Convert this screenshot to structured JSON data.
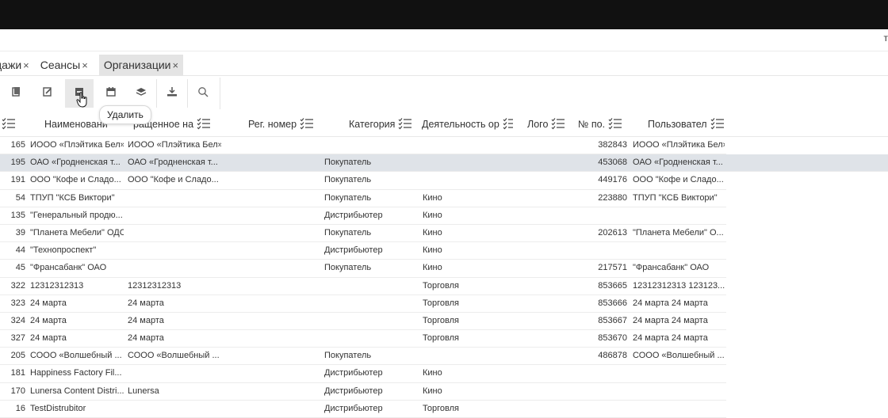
{
  "header": {
    "right_mark": "т"
  },
  "tabs": [
    {
      "label": "дажи",
      "close": "×"
    },
    {
      "label": "Сеансы",
      "close": "×"
    },
    {
      "label": "Организации",
      "close": "×",
      "active": true
    }
  ],
  "toolbar": {
    "buttons": [
      "copy-icon",
      "edit-icon",
      "delete-icon",
      "calendar-icon",
      "layers-icon",
      "download-icon",
      "search-icon"
    ],
    "tooltip": "Удалить"
  },
  "columns": {
    "name": "Наименовани",
    "short": "ращенное на",
    "reg": "Рег. номер",
    "category": "Категория",
    "activity": "Деятельность ор",
    "logo": "Лого",
    "num": "№ по.",
    "user": "Пользовател"
  },
  "rows": [
    {
      "id": "165",
      "name": "ИООО «Плэйтика Бел»",
      "short": "ИООО «Плэйтика Бел»",
      "category": "",
      "activity": "",
      "num": "382843",
      "user": "ИООО «Плэйтика Бел»"
    },
    {
      "id": "195",
      "name": "ОАО «Гродненская т...",
      "short": "ОАО «Гродненская т...",
      "category": "Покупатель",
      "activity": "",
      "num": "453068",
      "user": "ОАО «Гродненская т...",
      "selected": true
    },
    {
      "id": "191",
      "name": "ООО \"Кофе и Сладо...",
      "short": "ООО \"Кофе и Сладо...",
      "category": "Покупатель",
      "activity": "",
      "num": "449176",
      "user": "ООО \"Кофе и Сладо..."
    },
    {
      "id": "54",
      "name": "ТПУП \"КСБ Виктори\"",
      "short": "",
      "category": "Покупатель",
      "activity": "Кино",
      "num": "223880",
      "user": "ТПУП \"КСБ Виктори\""
    },
    {
      "id": "135",
      "name": "\"Генеральный продю...",
      "short": "",
      "category": "Дистрибьютер",
      "activity": "Кино",
      "num": "",
      "user": ""
    },
    {
      "id": "39",
      "name": "\"Планета Мебели\" ОДО",
      "short": "",
      "category": "Покупатель",
      "activity": "Кино",
      "num": "202613",
      "user": "\"Планета Мебели\" О..."
    },
    {
      "id": "44",
      "name": "\"Технопроспект\"",
      "short": "",
      "category": "Дистрибьютер",
      "activity": "Кино",
      "num": "",
      "user": ""
    },
    {
      "id": "45",
      "name": "\"Франсабанк\" ОАО",
      "short": "",
      "category": "Покупатель",
      "activity": "Кино",
      "num": "217571",
      "user": "\"Франсабанк\" ОАО"
    },
    {
      "id": "322",
      "name": "12312312313",
      "short": "12312312313",
      "category": "",
      "activity": "Торговля",
      "num": "853665",
      "user": "12312312313 123123..."
    },
    {
      "id": "323",
      "name": "24 марта",
      "short": "24 марта",
      "category": "",
      "activity": "Торговля",
      "num": "853666",
      "user": "24 марта 24 марта"
    },
    {
      "id": "324",
      "name": "24 марта",
      "short": "24 марта",
      "category": "",
      "activity": "Торговля",
      "num": "853667",
      "user": "24 марта 24 марта"
    },
    {
      "id": "327",
      "name": "24 марта",
      "short": "24 марта",
      "category": "",
      "activity": "Торговля",
      "num": "853670",
      "user": "24 марта 24 марта"
    },
    {
      "id": "205",
      "name": "СООО «Волшебный ...",
      "short": "СООО «Волшебный ...",
      "category": "Покупатель",
      "activity": "",
      "num": "486878",
      "user": "СООО «Волшебный ..."
    },
    {
      "id": "181",
      "name": "Happiness Factory Fil...",
      "short": "",
      "category": "Дистрибьютер",
      "activity": "Кино",
      "num": "",
      "user": ""
    },
    {
      "id": "170",
      "name": "Lunersa Content Distri...",
      "short": "Lunersa",
      "category": "Дистрибьютер",
      "activity": "Кино",
      "num": "",
      "user": ""
    },
    {
      "id": "16",
      "name": "TestDistrubitor",
      "short": "",
      "category": "Дистрибьютер",
      "activity": "Торговля",
      "num": "",
      "user": ""
    }
  ]
}
